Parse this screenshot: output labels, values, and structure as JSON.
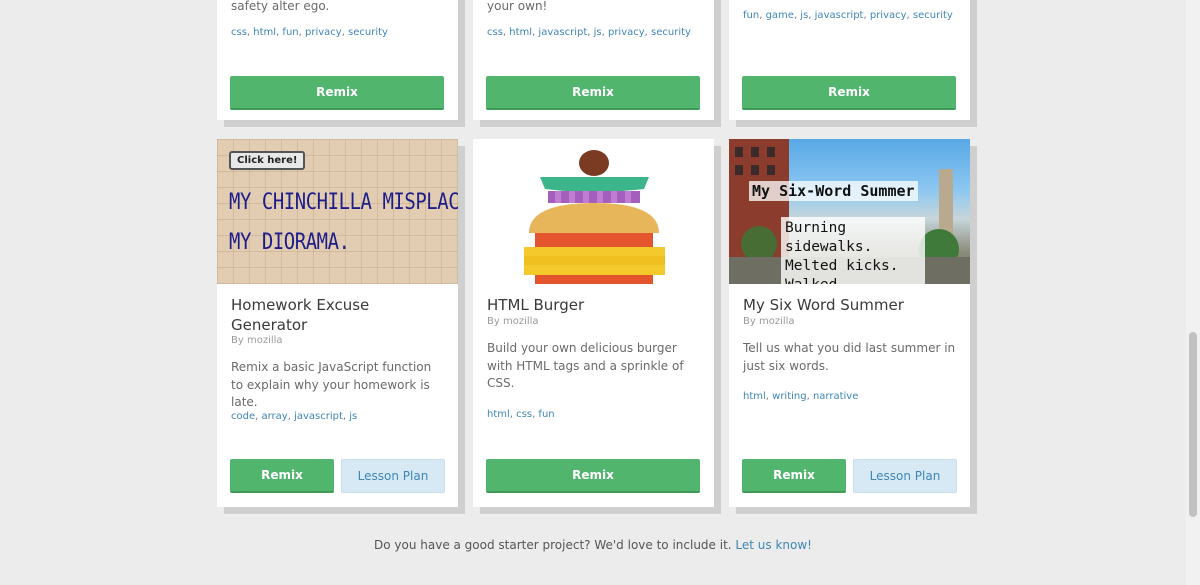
{
  "cards_top": [
    {
      "desc_tail": "safety alter ego.",
      "tags": [
        "css",
        "html",
        "fun",
        "privacy",
        "security"
      ],
      "remix_label": "Remix"
    },
    {
      "desc_tail": "your own!",
      "tags": [
        "css",
        "html",
        "javascript",
        "js",
        "privacy",
        "security"
      ],
      "remix_label": "Remix"
    },
    {
      "desc_tail": "",
      "tags": [
        "fun",
        "game",
        "js",
        "javascript",
        "privacy",
        "security"
      ],
      "remix_label": "Remix"
    }
  ],
  "cards": [
    {
      "title": "Homework Excuse Generator",
      "byline": "By mozilla",
      "description": "Remix a basic JavaScript function to explain why your homework is late.",
      "tags": [
        "code",
        "array",
        "javascript",
        "js"
      ],
      "remix_label": "Remix",
      "lesson_label": "Lesson Plan",
      "thumb": {
        "button_text": "Click here!",
        "line1": "MY CHINCHILLA MISPLACED",
        "line2": "MY DIORAMA."
      }
    },
    {
      "title": "HTML Burger",
      "byline": "By mozilla",
      "description": "Build your own delicious burger with HTML tags and a sprinkle of CSS.",
      "tags": [
        "html",
        "css",
        "fun"
      ],
      "remix_label": "Remix"
    },
    {
      "title": "My Six Word Summer",
      "byline": "By mozilla",
      "description": "Tell us what you did last summer in just six words.",
      "tags": [
        "html",
        "writing",
        "narrative"
      ],
      "remix_label": "Remix",
      "lesson_label": "Lesson Plan",
      "thumb": {
        "heading": "My Six-Word Summer",
        "body": "Burning\nsidewalks.\nMelted kicks.\nWalked"
      }
    }
  ],
  "footer": {
    "text": "Do you have a good starter project? We'd love to include it.",
    "link": "Let us know!"
  },
  "colors": {
    "remix": "#52b56e",
    "lesson_bg": "#d7e9f5",
    "link": "#3f86b5",
    "page_bg": "#ececec"
  }
}
